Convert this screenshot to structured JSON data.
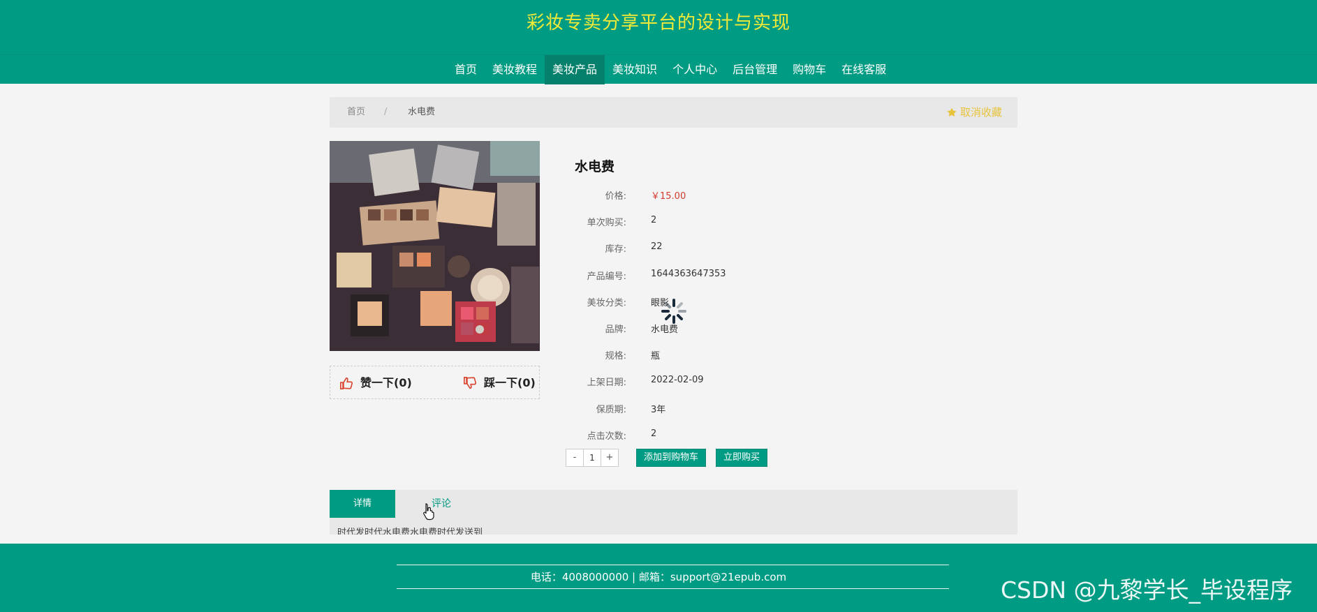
{
  "header": {
    "site_title": "彩妆专卖分享平台的设计与实现"
  },
  "nav": {
    "items": [
      {
        "label": "首页"
      },
      {
        "label": "美妆教程"
      },
      {
        "label": "美妆产品"
      },
      {
        "label": "美妆知识"
      },
      {
        "label": "个人中心"
      },
      {
        "label": "后台管理"
      },
      {
        "label": "购物车"
      },
      {
        "label": "在线客服"
      }
    ],
    "active": "美妆产品"
  },
  "breadcrumb": {
    "home": "首页",
    "separator": "/",
    "current": "水电费",
    "favorite_label": "取消收藏"
  },
  "votes": {
    "like_label": "赞一下(0)",
    "dislike_label": "踩一下(0)"
  },
  "product": {
    "title": "水电费",
    "fields": [
      {
        "label": "价格:",
        "value": "￥15.00"
      },
      {
        "label": "单次购买:",
        "value": "2"
      },
      {
        "label": "库存:",
        "value": "22"
      },
      {
        "label": "产品编号:",
        "value": "1644363647353"
      },
      {
        "label": "美妆分类:",
        "value": "眼影"
      },
      {
        "label": "品牌:",
        "value": "水电费"
      },
      {
        "label": "规格:",
        "value": "瓶"
      },
      {
        "label": "上架日期:",
        "value": "2022-02-09"
      },
      {
        "label": "保质期:",
        "value": "3年"
      },
      {
        "label": "点击次数:",
        "value": "2"
      }
    ]
  },
  "purchase": {
    "minus": "-",
    "quantity": "1",
    "plus": "+",
    "add_to_cart": "添加到购物车",
    "buy_now": "立即购买"
  },
  "tabs": {
    "detail": "详情",
    "comment": "评论",
    "detail_text": "时代发时代水电费水电费时代发送到"
  },
  "footer": {
    "contact": "电话：4008000000 | 邮箱：support@21epub.com",
    "watermark": "CSDN @九黎学长_毕设程序"
  },
  "colors": {
    "primary": "#009b83",
    "title_yellow": "#f2ea38",
    "price_red": "#d43a2e",
    "favorite_gold": "#e8c33c"
  }
}
